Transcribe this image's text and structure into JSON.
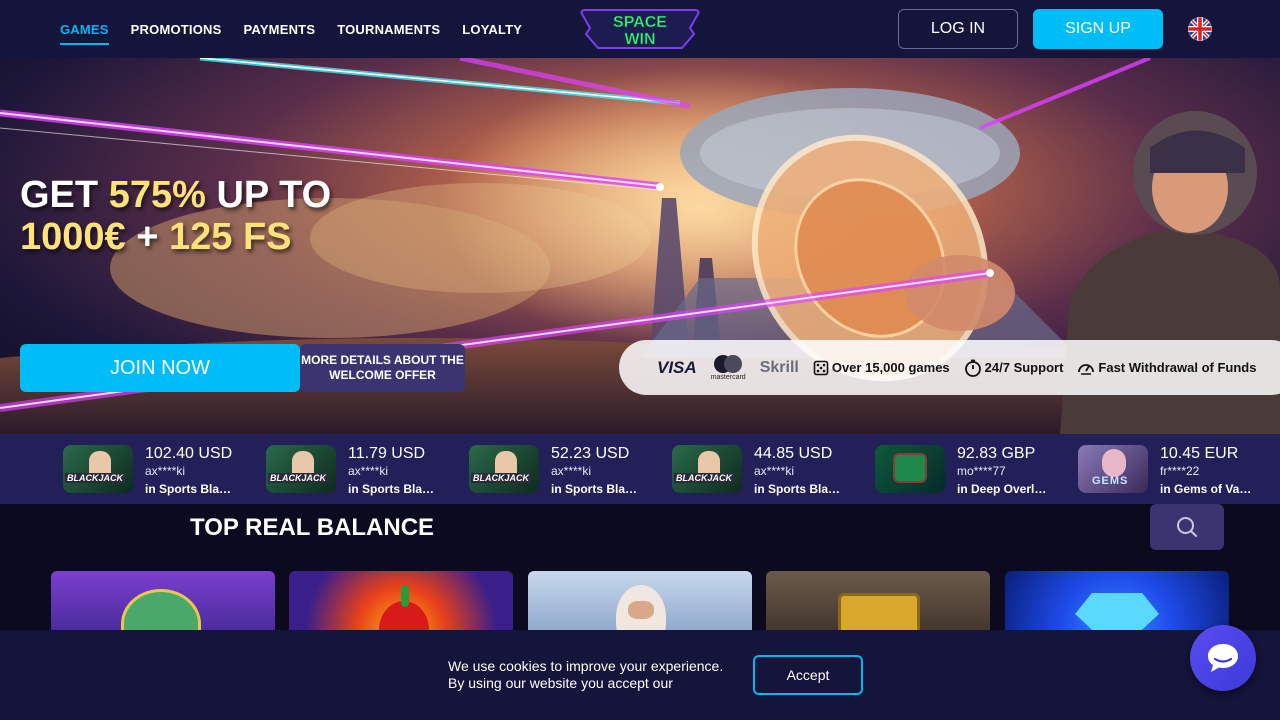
{
  "header": {
    "nav": [
      {
        "label": "GAMES",
        "active": true
      },
      {
        "label": "PROMOTIONS"
      },
      {
        "label": "PAYMENTS"
      },
      {
        "label": "TOURNAMENTS"
      },
      {
        "label": "LOYALTY"
      }
    ],
    "logo_text_top": "SPACE",
    "logo_text_bottom": "WIN",
    "login_label": "LOG IN",
    "signup_label": "SIGN UP",
    "language_icon": "uk-flag-icon"
  },
  "hero": {
    "title_part1": "GET ",
    "title_highlight1": "575%",
    "title_part2": " UP TO",
    "title_highlight2": "1000€",
    "title_part3": " + ",
    "title_highlight3": "125 FS",
    "join_label": "JOIN NOW",
    "details_label": "MORE DETAILS ABOUT THE WELCOME OFFER",
    "payments": {
      "visa": "VISA",
      "mastercard": "mastercard",
      "skrill": "Skrill"
    },
    "features": [
      {
        "icon": "dice-icon",
        "label": "Over 15,000 games"
      },
      {
        "icon": "stopwatch-icon",
        "label": "24/7 Support"
      },
      {
        "icon": "speedometer-icon",
        "label": "Fast Withdrawal of Funds"
      }
    ]
  },
  "winners": [
    {
      "amount": "102.40 USD",
      "user": "ax****ki",
      "game": "in Sports Blackjack",
      "thumb": "blackjack"
    },
    {
      "amount": "11.79 USD",
      "user": "ax****ki",
      "game": "in Sports Blackjack",
      "thumb": "blackjack"
    },
    {
      "amount": "52.23 USD",
      "user": "ax****ki",
      "game": "in Sports Blackjack",
      "thumb": "blackjack"
    },
    {
      "amount": "44.85 USD",
      "user": "ax****ki",
      "game": "in Sports Blackjack",
      "thumb": "blackjack"
    },
    {
      "amount": "92.83 GBP",
      "user": "mo****77",
      "game": "in Deep Overlord",
      "thumb": "green"
    },
    {
      "amount": "10.45 EUR",
      "user": "fr****22",
      "game": "in Gems of Valhalla",
      "thumb": "gems"
    }
  ],
  "section": {
    "title": "TOP REAL BALANCE",
    "search_icon": "search-icon"
  },
  "games": [
    {
      "name": "frog-game-tile",
      "color1": "#7a3fd0",
      "color2": "#2a1f78"
    },
    {
      "name": "fruit-game-tile",
      "color1": "#ff7a1a",
      "color2": "#3a1f8a"
    },
    {
      "name": "zeus-game-tile",
      "color1": "#c8d8ec",
      "color2": "#6a8ab8"
    },
    {
      "name": "treasure-game-tile",
      "color1": "#8a6a3a",
      "color2": "#3a2a1a"
    },
    {
      "name": "diamond-game-tile",
      "color1": "#1e6aff",
      "color2": "#0a1f7a"
    }
  ],
  "cookie": {
    "line1": "We use cookies to improve your experience.",
    "line2": "By using our website you accept our",
    "accept_label": "Accept"
  },
  "chat": {
    "icon": "chat-icon"
  }
}
